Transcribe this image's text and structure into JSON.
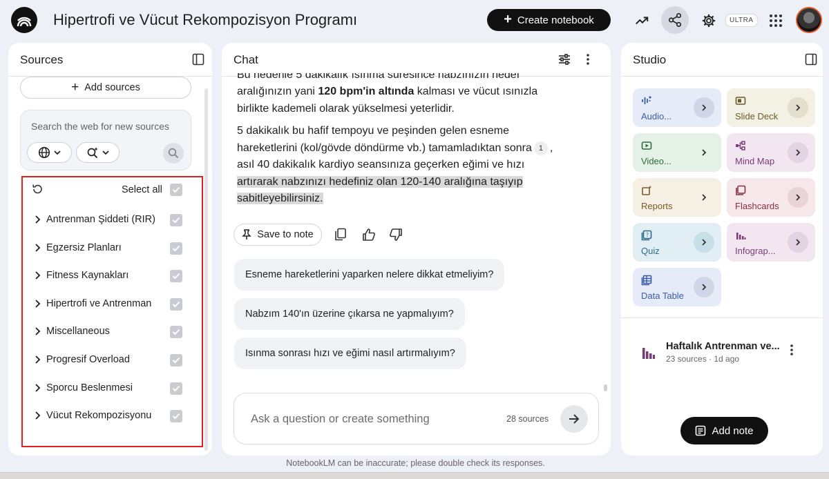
{
  "header": {
    "title": "Hipertrofi ve Vücut Rekompozisyon Programı",
    "create_label": "Create notebook",
    "badge": "ULTRA"
  },
  "sources": {
    "title": "Sources",
    "add_label": "Add sources",
    "search_placeholder": "Search the web for new sources",
    "select_all": "Select all",
    "items": [
      {
        "label": "Antrenman Şiddeti (RIR)"
      },
      {
        "label": "Egzersiz Planları"
      },
      {
        "label": "Fitness Kaynakları"
      },
      {
        "label": "Hipertrofi ve Antrenman"
      },
      {
        "label": "Miscellaneous"
      },
      {
        "label": "Progresif Overload"
      },
      {
        "label": "Sporcu Beslenmesi"
      },
      {
        "label": "Vücut Rekompozisyonu"
      }
    ]
  },
  "chat": {
    "title": "Chat",
    "partial_line": "Bu nedenle 5 dakikalık ısınma süresince nabzınızın hedef",
    "p1_a": "aralığınızın yani ",
    "p1_bold": "120 bpm'in altında",
    "p1_b": " kalması ve vücut ısınızla birlikte kademeli olarak yükselmesi yeterlidir.",
    "p2_a": "5 dakikalık bu hafif tempoyu ve peşinden gelen esneme hareketlerini (kol/gövde döndürme vb.) tamamladıktan sonra",
    "citation": "1",
    "p2_b": ", asıl 40 dakikalık kardiyo seansınıza geçerken eğimi ve hızı ",
    "p2_hl": "artırarak nabzınızı hedefiniz olan 120-140 aralığına taşıyıp sabitleyebilirsiniz.",
    "save_label": "Save to note",
    "suggestions": [
      "Esneme hareketlerini yaparken nelere dikkat etmeliyim?",
      "Nabzım 140'ın üzerine çıkarsa ne yapmalıyım?",
      "Isınma sonrası hızı ve eğimi nasıl artırmalıyım?"
    ],
    "input_placeholder": "Ask a question or create something",
    "source_count": "28 sources"
  },
  "studio": {
    "title": "Studio",
    "tiles": [
      {
        "label": "Audio...",
        "color": "#e6ebf8",
        "accent": "#3b5ba8"
      },
      {
        "label": "Slide Deck",
        "color": "#f3f1e4",
        "accent": "#6b5a2a"
      },
      {
        "label": "Video...",
        "color": "#e3f1e6",
        "accent": "#2f6b3d"
      },
      {
        "label": "Mind Map",
        "color": "#f2e7f1",
        "accent": "#7a3a78"
      },
      {
        "label": "Reports",
        "color": "#f6efe3",
        "accent": "#7a5a2a"
      },
      {
        "label": "Flashcards",
        "color": "#f6e7ea",
        "accent": "#8a2f40"
      },
      {
        "label": "Quiz",
        "color": "#e1eff5",
        "accent": "#2a6a85"
      },
      {
        "label": "Infograp...",
        "color": "#f2e7f1",
        "accent": "#7a3a78"
      },
      {
        "label": "Data Table",
        "color": "#e6ebf8",
        "accent": "#3b5ba8"
      }
    ],
    "note": {
      "title": "Haftalık Antrenman ve...",
      "meta": "23 sources · 1d ago"
    },
    "add_note_label": "Add note"
  },
  "footer": "NotebookLM can be inaccurate; please double check its responses."
}
